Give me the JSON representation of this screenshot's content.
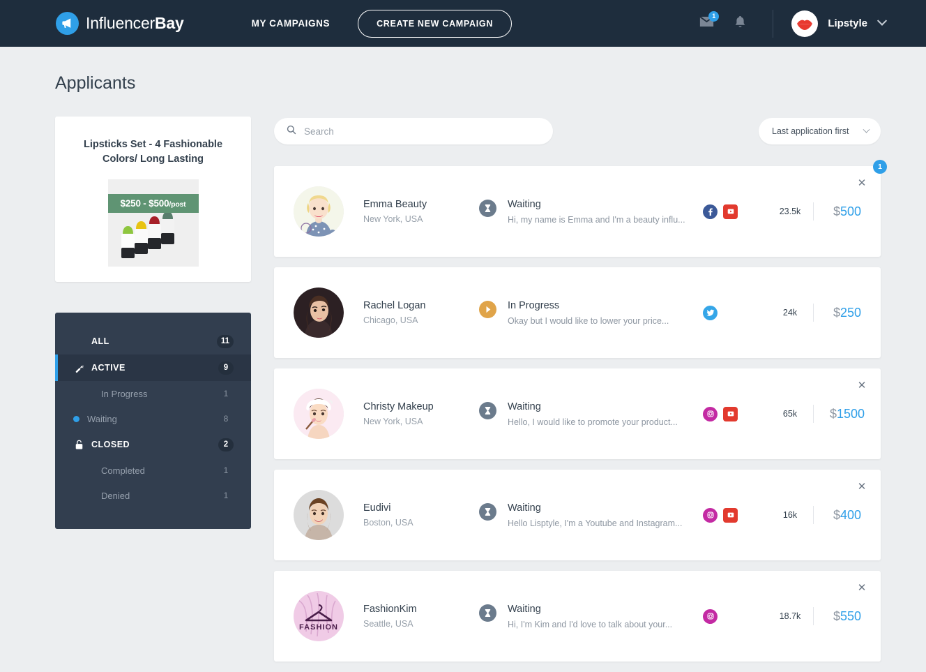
{
  "header": {
    "brand_light": "Influencer",
    "brand_bold": "Bay",
    "brand_icon": "megaphone-icon",
    "nav_my_campaigns": "MY CAMPAIGNS",
    "cta_create_campaign": "CREATE NEW CAMPAIGN",
    "mail_icon": "envelope-icon",
    "mail_badge": "1",
    "bell_icon": "bell-icon",
    "user_avatar_icon": "lips-avatar",
    "user_name": "Lipstyle",
    "user_caret_icon": "chevron-down-icon"
  },
  "page": {
    "title": "Applicants",
    "background": "#eceef0",
    "accent": "#2f9fe8"
  },
  "campaign": {
    "title": "Lipsticks Set - 4 Fashionable Colors/ Long Lasting",
    "price_range": "$250 - $500",
    "price_unit": "/post",
    "ribbon_color": "#5f9473",
    "thumbnail_icon": "lipsticks-photo"
  },
  "filters": [
    {
      "label": "ALL",
      "count": "11",
      "level": "primary",
      "icon": null,
      "active": false,
      "dot": false
    },
    {
      "label": "ACTIVE",
      "count": "9",
      "level": "primary",
      "icon": "wrench-icon",
      "active": true,
      "dot": false
    },
    {
      "label": "In Progress",
      "count": "1",
      "level": "sub",
      "icon": null,
      "active": false,
      "dot": false
    },
    {
      "label": "Waiting",
      "count": "8",
      "level": "sub",
      "icon": null,
      "active": false,
      "dot": true
    },
    {
      "label": "CLOSED",
      "count": "2",
      "level": "primary",
      "icon": "lock-icon",
      "active": false,
      "dot": false
    },
    {
      "label": "Completed",
      "count": "1",
      "level": "sub",
      "icon": null,
      "active": false,
      "dot": false
    },
    {
      "label": "Denied",
      "count": "1",
      "level": "sub",
      "icon": null,
      "active": false,
      "dot": false
    }
  ],
  "toolbar": {
    "search_value": "",
    "search_placeholder": "Search",
    "search_icon": "search-icon",
    "sort_selected": "Last application first",
    "sort_caret_icon": "chevron-down-icon"
  },
  "applicants": [
    {
      "avatar": "emma-avatar",
      "name": "Emma Beauty",
      "location": "New York, USA",
      "status": "Waiting",
      "status_type": "waiting",
      "status_icon": "hourglass-icon",
      "message": "Hi, my name is Emma and I'm a beauty influ...",
      "socials": [
        "facebook",
        "youtube"
      ],
      "followers": "23.5k",
      "price_currency": "$",
      "price_value": "500",
      "badge": "1",
      "has_close": true
    },
    {
      "avatar": "rachel-avatar",
      "name": "Rachel Logan",
      "location": "Chicago, USA",
      "status": "In Progress",
      "status_type": "progress",
      "status_icon": "play-icon",
      "message": "Okay but I would like to lower your price...",
      "socials": [
        "twitter"
      ],
      "followers": "24k",
      "price_currency": "$",
      "price_value": "250",
      "badge": null,
      "has_close": false
    },
    {
      "avatar": "christy-avatar",
      "name": "Christy Makeup",
      "location": "New York, USA",
      "status": "Waiting",
      "status_type": "waiting",
      "status_icon": "hourglass-icon",
      "message": "Hello, I would like to promote your product...",
      "socials": [
        "instagram",
        "youtube-round"
      ],
      "followers": "65k",
      "price_currency": "$",
      "price_value": "1500",
      "badge": null,
      "has_close": true
    },
    {
      "avatar": "eudivi-avatar",
      "name": "Eudivi",
      "location": "Boston, USA",
      "status": "Waiting",
      "status_type": "waiting",
      "status_icon": "hourglass-icon",
      "message": "Hello Lisptyle, I'm a Youtube and Instagram...",
      "socials": [
        "instagram",
        "youtube-round"
      ],
      "followers": "16k",
      "price_currency": "$",
      "price_value": "400",
      "badge": null,
      "has_close": true
    },
    {
      "avatar": "fashionkim-avatar",
      "name": "FashionKim",
      "location": "Seattle, USA",
      "status": "Waiting",
      "status_type": "waiting",
      "status_icon": "hourglass-icon",
      "message": "Hi, I'm Kim and I'd love to talk about your...",
      "socials": [
        "instagram"
      ],
      "followers": "18.7k",
      "price_currency": "$",
      "price_value": "550",
      "badge": null,
      "has_close": true
    }
  ]
}
